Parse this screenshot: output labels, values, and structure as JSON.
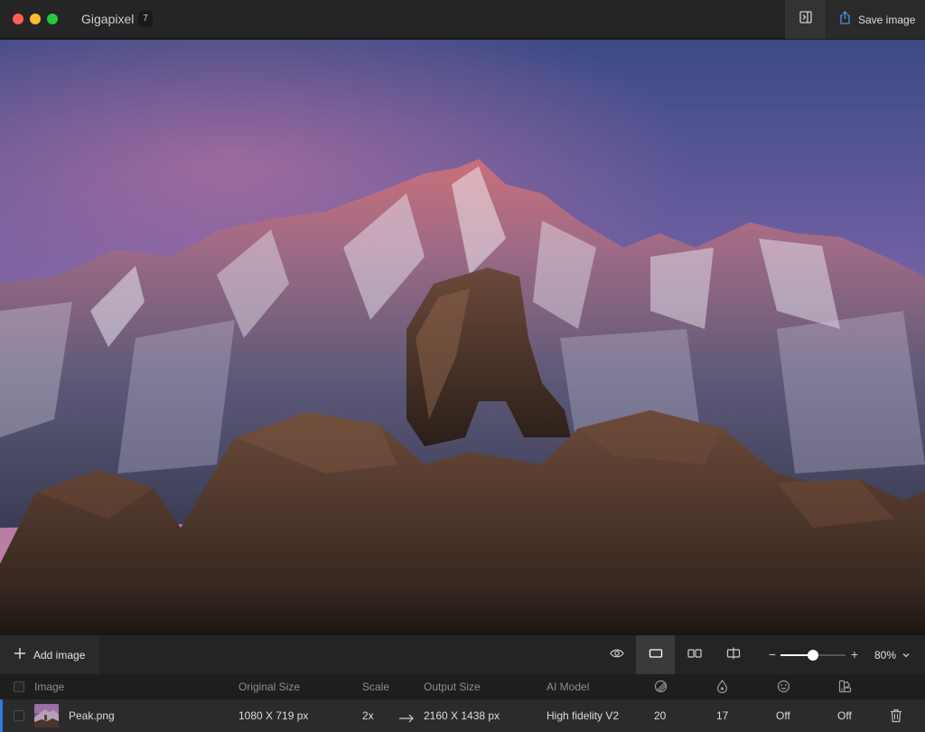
{
  "app": {
    "title": "Gigapixel",
    "image_count": "7"
  },
  "titlebar": {
    "save_label": "Save image"
  },
  "toolbar": {
    "add_image_label": "Add image",
    "zoom": {
      "value": "80%",
      "level_fraction": 0.5
    }
  },
  "table": {
    "columns": {
      "image": "Image",
      "original_size": "Original Size",
      "scale": "Scale",
      "output_size": "Output Size",
      "ai_model": "AI Model"
    },
    "rows": [
      {
        "name": "Peak.png",
        "original_size": "1080 X 719 px",
        "scale": "2x",
        "output_size": "2160 X 1438 px",
        "ai_model": "High fidelity V2",
        "suppress_noise": "20",
        "remove_blur": "17",
        "face_recovery": "Off",
        "gamma": "Off"
      }
    ]
  },
  "colors": {
    "accent": "#2f7be5",
    "background": "#1e1e1e",
    "toolbar": "#242424"
  },
  "icons": [
    "panel-toggle-icon",
    "share-icon",
    "plus-icon",
    "eye-icon",
    "single-view-icon",
    "side-by-side-icon",
    "split-view-icon",
    "chevron-down-icon",
    "noise-icon",
    "drop-icon",
    "face-icon",
    "palette-icon",
    "trash-icon"
  ]
}
